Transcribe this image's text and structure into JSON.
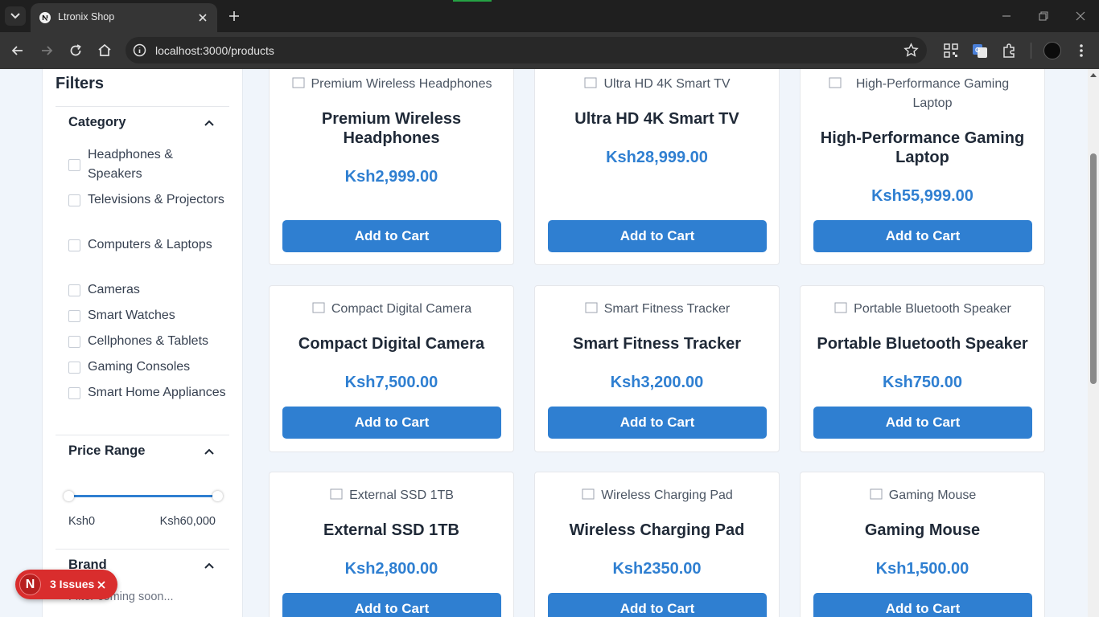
{
  "browser": {
    "tab_title": "Ltronix Shop",
    "url": "localhost:3000/products"
  },
  "sidebar": {
    "title": "Filters",
    "category": {
      "title": "Category",
      "items": [
        {
          "label": "Headphones & Speakers",
          "checked": false
        },
        {
          "label": "Televisions & Projectors",
          "checked": false
        },
        {
          "label": "Computers & Laptops",
          "checked": false
        },
        {
          "label": "Cameras",
          "checked": false
        },
        {
          "label": "Smart Watches",
          "checked": false
        },
        {
          "label": "Cellphones & Tablets",
          "checked": false
        },
        {
          "label": "Gaming Consoles",
          "checked": false
        },
        {
          "label": "Smart Home Appliances",
          "checked": false
        }
      ]
    },
    "price_range": {
      "title": "Price Range",
      "min_label": "Ksh0",
      "max_label": "Ksh60,000"
    },
    "brand": {
      "title": "Brand",
      "note": "Filter coming soon..."
    }
  },
  "products": [
    {
      "image_alt": "Premium Wireless Headphones",
      "name": "Premium Wireless Headphones",
      "price": "Ksh2,999.00",
      "button": "Add to Cart"
    },
    {
      "image_alt": "Ultra HD 4K Smart TV",
      "name": "Ultra HD 4K Smart TV",
      "price": "Ksh28,999.00",
      "button": "Add to Cart"
    },
    {
      "image_alt": "High-Performance Gaming Laptop",
      "name": "High-Performance Gaming Laptop",
      "price": "Ksh55,999.00",
      "button": "Add to Cart"
    },
    {
      "image_alt": "Compact Digital Camera",
      "name": "Compact Digital Camera",
      "price": "Ksh7,500.00",
      "button": "Add to Cart"
    },
    {
      "image_alt": "Smart Fitness Tracker",
      "name": "Smart Fitness Tracker",
      "price": "Ksh3,200.00",
      "button": "Add to Cart"
    },
    {
      "image_alt": "Portable Bluetooth Speaker",
      "name": "Portable Bluetooth Speaker",
      "price": "Ksh750.00",
      "button": "Add to Cart"
    },
    {
      "image_alt": "External SSD 1TB",
      "name": "External SSD 1TB",
      "price": "Ksh2,800.00",
      "button": "Add to Cart"
    },
    {
      "image_alt": "Wireless Charging Pad",
      "name": "Wireless Charging Pad",
      "price": "Ksh2350.00",
      "button": "Add to Cart"
    },
    {
      "image_alt": "Gaming Mouse",
      "name": "Gaming Mouse",
      "price": "Ksh1,500.00",
      "button": "Add to Cart"
    }
  ],
  "issues_badge": {
    "letter": "N",
    "text": "3 Issues"
  },
  "colors": {
    "accent": "#2f7fd1",
    "page_bg": "#f0f5fb",
    "issues_red": "#d92d2d"
  }
}
